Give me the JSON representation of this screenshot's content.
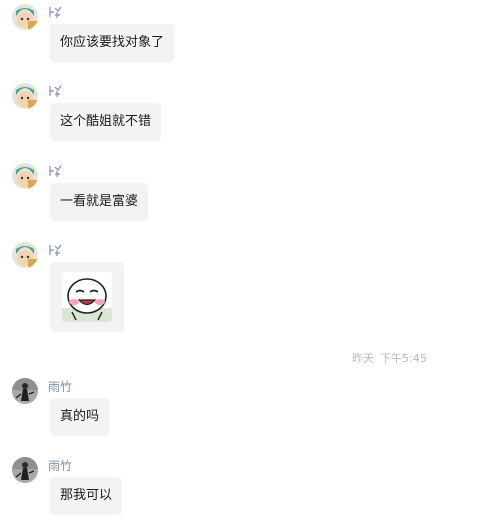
{
  "messages": [
    {
      "sender": "",
      "sender_icon": "pinyin-name-icon",
      "avatar": "anime-avatar",
      "text": "你应该要找对象了"
    },
    {
      "sender": "",
      "sender_icon": "pinyin-name-icon",
      "avatar": "anime-avatar",
      "text": "这个酷姐就不错"
    },
    {
      "sender": "",
      "sender_icon": "pinyin-name-icon",
      "avatar": "anime-avatar",
      "text": "一看就是富婆"
    },
    {
      "sender": "",
      "sender_icon": "pinyin-name-icon",
      "avatar": "anime-avatar",
      "sticker": "smirk-sticker"
    },
    {
      "sender": "雨竹",
      "avatar": "grey-figure-avatar",
      "text": "真的吗"
    },
    {
      "sender": "雨竹",
      "avatar": "grey-figure-avatar",
      "text": "那我可以"
    }
  ],
  "timestamp": {
    "day": "昨天",
    "time": "下午5:45"
  },
  "colors": {
    "bubble": "#f3f3f3",
    "sender_name": "#7c8db0",
    "timestamp": "#b8b8b8"
  }
}
